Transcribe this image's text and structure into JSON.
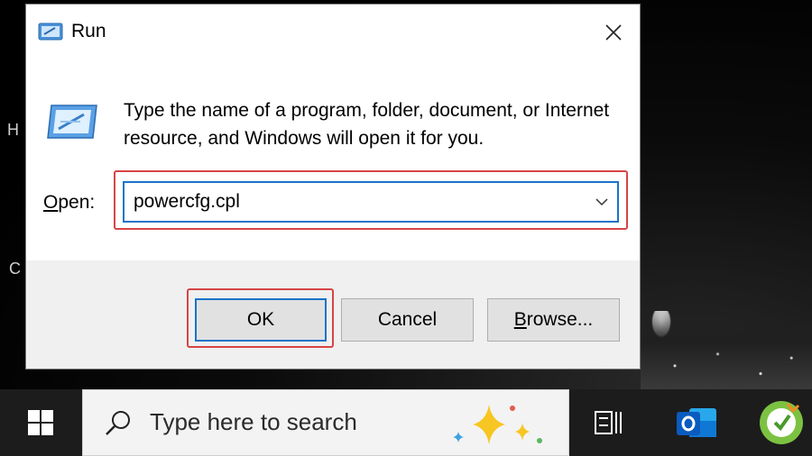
{
  "desktop": {
    "glyphs": [
      "H",
      "C"
    ]
  },
  "dialog": {
    "title": "Run",
    "title_icon": "run-icon",
    "close_icon": "close-icon",
    "description": "Type the name of a program, folder, document, or Internet resource, and Windows will open it for you.",
    "open_label_underlined": "O",
    "open_label_rest": "pen:",
    "open_value": "powercfg.cpl",
    "dropdown_icon": "chevron-down-icon",
    "buttons": {
      "ok": "OK",
      "cancel": "Cancel",
      "browse_underlined": "B",
      "browse_rest": "rowse..."
    },
    "highlight_color": "#d64545",
    "focus_color": "#1a73c8"
  },
  "taskbar": {
    "start_icon": "windows-start-icon",
    "search_placeholder": "Type here to search",
    "search_icon": "search-icon",
    "copilot_icon": "copilot-sparkle-icon",
    "taskview_icon": "task-view-icon",
    "outlook_icon": "outlook-icon",
    "app_icon": "green-app-icon"
  }
}
